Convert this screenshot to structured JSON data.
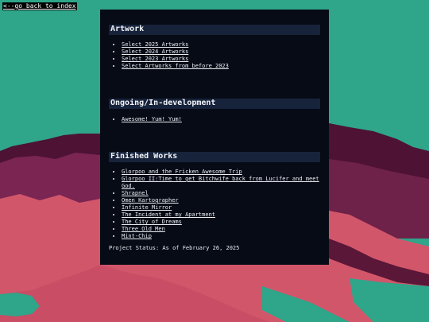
{
  "nav": {
    "back_label": "<--go back to index"
  },
  "sections": {
    "artwork": {
      "title": "Artwork",
      "items": [
        "Select 2025 Artworks",
        "Select 2024 Artworks",
        "Select 2023 Artworks",
        "Select Artworks from before 2023"
      ]
    },
    "ongoing": {
      "title": "Ongoing/In-development",
      "items": [
        "Awesome! Yum! Yum!"
      ]
    },
    "finished": {
      "title": "Finished Works",
      "items": [
        "Glorpoo and the Fricken Awesome Trip",
        "Glorpoo II:Time to get Bitchwife back from Lucifer and meet God.",
        "Shrapnel",
        "Omen Kartographer",
        "Infinite Mirror",
        "The Incident at my Apartment",
        "The City of Dreams",
        "Three Old Men",
        "Mint-Chip"
      ]
    }
  },
  "status": "Project Status: As of February 26, 2025",
  "colors": {
    "background_teal": "#2fa58a",
    "panel": "#070b15",
    "header_bar": "#17233b",
    "mountain_pink": "#d2566a",
    "mountain_dark": "#5a1738"
  }
}
